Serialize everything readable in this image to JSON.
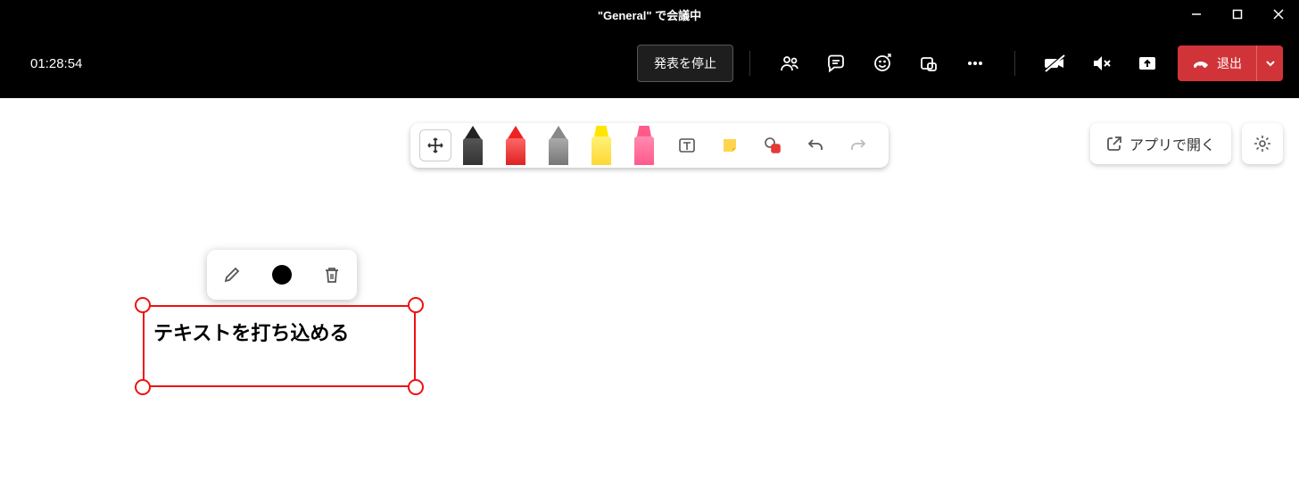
{
  "titlebar": {
    "title": "\"General\" で会議中"
  },
  "meetbar": {
    "timer": "01:28:54",
    "stop_present_label": "発表を停止",
    "leave_label": "退出",
    "icons": {
      "participants": "participants-icon",
      "chat": "chat-icon",
      "reactions": "reactions-icon",
      "breakout": "breakout-rooms-icon",
      "more": "more-icon",
      "camera": "camera-off-icon",
      "mic": "mic-off-icon",
      "share": "share-screen-icon"
    }
  },
  "whiteboard": {
    "open_in_app_label": "アプリで開く",
    "tools": {
      "move": "move-tool",
      "pen_black": "pen-black",
      "pen_red": "pen-red",
      "pen_gray": "pen-gray",
      "highlighter_yellow": "highlighter-yellow",
      "highlighter_pink": "highlighter-pink",
      "text": "text-tool",
      "note": "sticky-note-tool",
      "shape": "shape-tool",
      "undo": "undo",
      "redo": "redo"
    },
    "textbox": {
      "text": "テキストを打ち込める",
      "border_color": "#e11",
      "context": {
        "edit": "edit-icon",
        "color": "#000000",
        "delete": "trash-icon"
      }
    }
  }
}
